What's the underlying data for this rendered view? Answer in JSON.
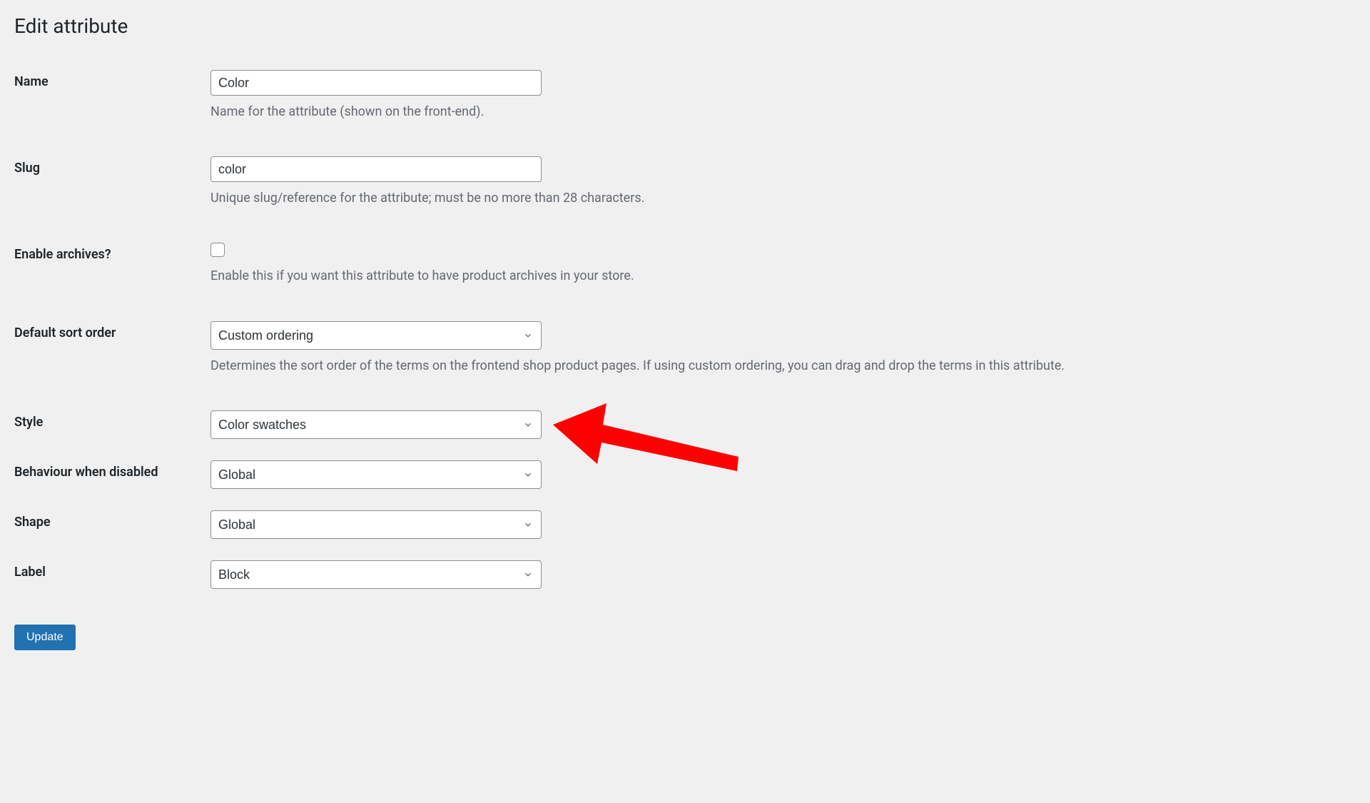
{
  "page": {
    "title": "Edit attribute"
  },
  "fields": {
    "name": {
      "label": "Name",
      "value": "Color",
      "help": "Name for the attribute (shown on the front-end)."
    },
    "slug": {
      "label": "Slug",
      "value": "color",
      "help": "Unique slug/reference for the attribute; must be no more than 28 characters."
    },
    "enable_archives": {
      "label": "Enable archives?",
      "help": "Enable this if you want this attribute to have product archives in your store."
    },
    "default_sort_order": {
      "label": "Default sort order",
      "value": "Custom ordering",
      "help": "Determines the sort order of the terms on the frontend shop product pages. If using custom ordering, you can drag and drop the terms in this attribute."
    },
    "style": {
      "label": "Style",
      "value": "Color swatches"
    },
    "behaviour_disabled": {
      "label": "Behaviour when disabled",
      "value": "Global"
    },
    "shape": {
      "label": "Shape",
      "value": "Global"
    },
    "label_field": {
      "label": "Label",
      "value": "Block"
    }
  },
  "buttons": {
    "update": "Update"
  }
}
